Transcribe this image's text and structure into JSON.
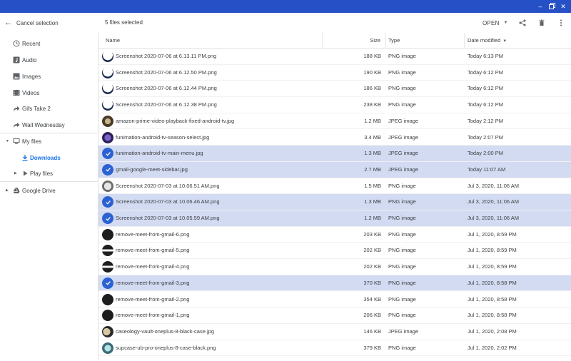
{
  "toolbar": {
    "cancel_label": "Cancel selection",
    "selection_count": "5 files selected",
    "open_label": "OPEN"
  },
  "sidebar": {
    "items": [
      {
        "label": "Recent",
        "icon": "clock-icon"
      },
      {
        "label": "Audio",
        "icon": "audio-icon"
      },
      {
        "label": "Images",
        "icon": "image-icon"
      },
      {
        "label": "Videos",
        "icon": "video-icon"
      },
      {
        "label": "Gifs Take 2",
        "icon": "shared-arrow-icon"
      },
      {
        "label": "Wall Wednesday",
        "icon": "shared-arrow-icon"
      },
      {
        "label": "My files",
        "icon": "computer-icon"
      },
      {
        "label": "Downloads",
        "icon": "download-icon"
      },
      {
        "label": "Play files",
        "icon": "play-folder-icon"
      },
      {
        "label": "Google Drive",
        "icon": "drive-icon"
      }
    ]
  },
  "columns": {
    "name": "Name",
    "size": "Size",
    "type": "Type",
    "date": "Date modified"
  },
  "files": [
    {
      "name": "Screenshot 2020-07-06 at 6.13.11 PM.png",
      "size": "188 KB",
      "type": "PNG image",
      "date": "Today 6:13 PM",
      "selected": false,
      "thumb": "screenshot"
    },
    {
      "name": "Screenshot 2020-07-06 at 6.12.50 PM.png",
      "size": "190 KB",
      "type": "PNG image",
      "date": "Today 6:12 PM",
      "selected": false,
      "thumb": "screenshot"
    },
    {
      "name": "Screenshot 2020-07-06 at 6.12.44 PM.png",
      "size": "186 KB",
      "type": "PNG image",
      "date": "Today 6:12 PM",
      "selected": false,
      "thumb": "screenshot"
    },
    {
      "name": "Screenshot 2020-07-06 at 6.12.38 PM.png",
      "size": "238 KB",
      "type": "PNG image",
      "date": "Today 6:12 PM",
      "selected": false,
      "thumb": "screenshot"
    },
    {
      "name": "amazon-prime-video-playback-fixed-android-tv.jpg",
      "size": "1.2 MB",
      "type": "JPEG image",
      "date": "Today 2:12 PM",
      "selected": false,
      "thumb": "photo"
    },
    {
      "name": "funimation-android-tv-season-select.jpg",
      "size": "3.4 MB",
      "type": "JPEG image",
      "date": "Today 2:07 PM",
      "selected": false,
      "thumb": "purple"
    },
    {
      "name": "funimation-android-tv-main-menu.jpg",
      "size": "1.3 MB",
      "type": "JPEG image",
      "date": "Today 2:00 PM",
      "selected": true,
      "thumb": "purple"
    },
    {
      "name": "gmail-google-meet-sidebar.jpg",
      "size": "2.7 MB",
      "type": "JPEG image",
      "date": "Today 11:07 AM",
      "selected": true,
      "thumb": "screenshot"
    },
    {
      "name": "Screenshot 2020-07-03 at 10.06.51 AM.png",
      "size": "1.5 MB",
      "type": "PNG image",
      "date": "Jul 3, 2020, 11:06 AM",
      "selected": false,
      "thumb": "gray"
    },
    {
      "name": "Screenshot 2020-07-03 at 10.06.46 AM.png",
      "size": "1.3 MB",
      "type": "PNG image",
      "date": "Jul 3, 2020, 11:06 AM",
      "selected": true,
      "thumb": "gray"
    },
    {
      "name": "Screenshot 2020-07-03 at 10.05.59 AM.png",
      "size": "1.2 MB",
      "type": "PNG image",
      "date": "Jul 3, 2020, 11:06 AM",
      "selected": true,
      "thumb": "gray"
    },
    {
      "name": "remove-meet-from-gmail-6.png",
      "size": "203 KB",
      "type": "PNG image",
      "date": "Jul 1, 2020, 8:59 PM",
      "selected": false,
      "thumb": "dark"
    },
    {
      "name": "remove-meet-from-gmail-5.png",
      "size": "202 KB",
      "type": "PNG image",
      "date": "Jul 1, 2020, 8:59 PM",
      "selected": false,
      "thumb": "darkband"
    },
    {
      "name": "remove-meet-from-gmail-4.png",
      "size": "202 KB",
      "type": "PNG image",
      "date": "Jul 1, 2020, 8:59 PM",
      "selected": false,
      "thumb": "darkband"
    },
    {
      "name": "remove-meet-from-gmail-3.png",
      "size": "370 KB",
      "type": "PNG image",
      "date": "Jul 1, 2020, 8:58 PM",
      "selected": true,
      "thumb": "dark"
    },
    {
      "name": "remove-meet-from-gmail-2.png",
      "size": "354 KB",
      "type": "PNG image",
      "date": "Jul 1, 2020, 8:58 PM",
      "selected": false,
      "thumb": "dark"
    },
    {
      "name": "remove-meet-from-gmail-1.png",
      "size": "206 KB",
      "type": "PNG image",
      "date": "Jul 1, 2020, 8:58 PM",
      "selected": false,
      "thumb": "dark"
    },
    {
      "name": "caseology-vault-oneplus-8-black-case.jpg",
      "size": "146 KB",
      "type": "JPEG image",
      "date": "Jul 1, 2020, 2:08 PM",
      "selected": false,
      "thumb": "case"
    },
    {
      "name": "supcase-ub-pro-oneplus-8-case-black.png",
      "size": "379 KB",
      "type": "PNG image",
      "date": "Jul 1, 2020, 2:02 PM",
      "selected": false,
      "thumb": "teal"
    }
  ],
  "colors": {
    "titlebar": "#2650c5",
    "selection": "#d3dbf2",
    "check": "#2b62d1",
    "active_nav": "#1a73e8"
  }
}
